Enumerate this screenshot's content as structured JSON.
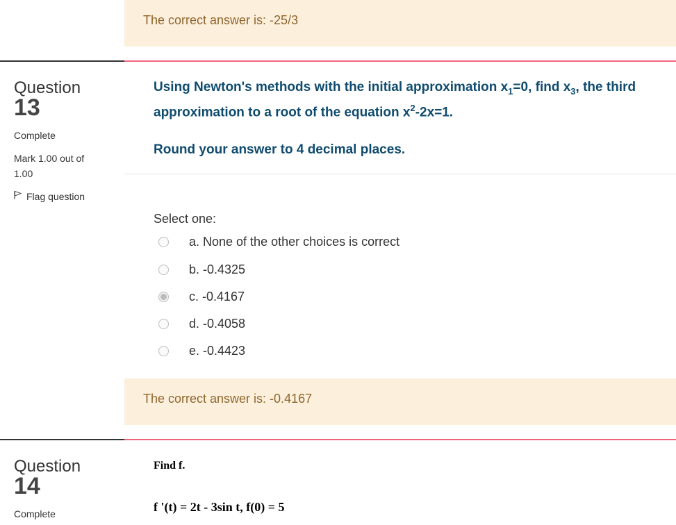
{
  "feedback_top": {
    "text": "The correct answer is: -25/3"
  },
  "q13": {
    "word": "Question",
    "number": "13",
    "state": "Complete",
    "mark_line1": "Mark 1.00 out of",
    "mark_line2": "1.00",
    "flag": "Flag question",
    "text_line1_a": "Using Newton's methods with the initial approximation x",
    "sub_1": "1",
    "text_line1_b": "=0, find x",
    "sub_3": "3",
    "text_line1_c": ", the third",
    "text_line2_a": "approximation to a root of the equation x",
    "sup_2": "2",
    "text_line2_b": "-2x=1.",
    "round_text": "Round your answer to 4 decimal places.",
    "select_one": "Select one:",
    "options": [
      {
        "label": "a. None of the other choices is correct",
        "checked": false
      },
      {
        "label": "b. -0.4325",
        "checked": false
      },
      {
        "label": "c. -0.4167",
        "checked": true
      },
      {
        "label": "d. -0.4058",
        "checked": false
      },
      {
        "label": "e. -0.4423",
        "checked": false
      }
    ],
    "feedback": "The correct answer is: -0.4167"
  },
  "q14": {
    "word": "Question",
    "number": "14",
    "state": "Complete",
    "find": "Find f.",
    "equation": "f '(t) = 2t - 3sin t, f(0) = 5"
  }
}
